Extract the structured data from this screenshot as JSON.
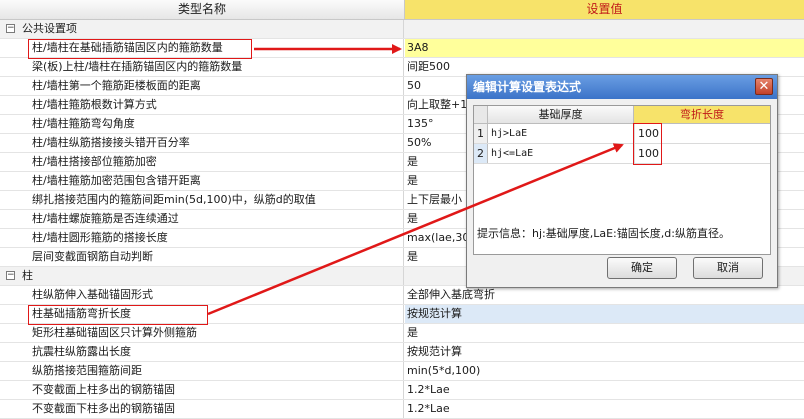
{
  "header": {
    "name_col": "类型名称",
    "value_col": "设置值"
  },
  "groups": [
    {
      "label": "公共设置项",
      "expander": "−",
      "rows": [
        {
          "name": "柱/墙柱在基础插筋锚固区内的箍筋数量",
          "value": "3A8"
        },
        {
          "name": "梁(板)上柱/墙柱在插筋锚固区内的箍筋数量",
          "value": "间距500"
        },
        {
          "name": "柱/墙柱第一个箍筋距楼板面的距离",
          "value": "50"
        },
        {
          "name": "柱/墙柱箍筋根数计算方式",
          "value": "向上取整+1"
        },
        {
          "name": "柱/墙柱箍筋弯勾角度",
          "value": "135°"
        },
        {
          "name": "柱/墙柱纵筋搭接接头错开百分率",
          "value": "50%"
        },
        {
          "name": "柱/墙柱搭接部位箍筋加密",
          "value": "是"
        },
        {
          "name": "柱/墙柱箍筋加密范围包含错开距离",
          "value": "是"
        },
        {
          "name": "绑扎搭接范围内的箍筋间距min(5d,100)中，纵筋d的取值",
          "value": "上下层最小"
        },
        {
          "name": "柱/墙柱螺旋箍筋是否连续通过",
          "value": "是"
        },
        {
          "name": "柱/墙柱圆形箍筋的搭接长度",
          "value": "max(lae,30"
        },
        {
          "name": "层间变截面钢筋自动判断",
          "value": "是"
        }
      ]
    },
    {
      "label": "柱",
      "expander": "−",
      "rows": [
        {
          "name": "柱纵筋伸入基础锚固形式",
          "value": "全部伸入基底弯折"
        },
        {
          "name": "柱基础插筋弯折长度",
          "value": "按规范计算"
        },
        {
          "name": "矩形柱基础锚固区只计算外侧箍筋",
          "value": "是"
        },
        {
          "name": "抗震柱纵筋露出长度",
          "value": "按规范计算"
        },
        {
          "name": "纵筋搭接范围箍筋间距",
          "value": "min(5*d,100)"
        },
        {
          "name": "不变截面上柱多出的钢筋锚固",
          "value": "1.2*Lae"
        },
        {
          "name": "不变截面下柱多出的钢筋锚固",
          "value": "1.2*Lae"
        }
      ]
    }
  ],
  "dialog": {
    "title": "编辑计算设置表达式",
    "close_glyph": "✕",
    "columns": [
      "基础厚度",
      "弯折长度"
    ],
    "rows": [
      {
        "index": "1",
        "condition": "hj>LaE",
        "value": "100"
      },
      {
        "index": "2",
        "condition": "hj<=LaE",
        "value": "100"
      }
    ],
    "info": "提示信息：hj:基础厚度,LaE:锚固长度,d:纵筋直径。",
    "ok_label": "确定",
    "cancel_label": "取消"
  },
  "colors": {
    "header_value_bg": "#f7e36a",
    "header_value_text": "#c01818",
    "highlight_row": "#ffff9b",
    "annotation_red": "#e01818",
    "dialog_title_bg": "#3b73c8"
  }
}
